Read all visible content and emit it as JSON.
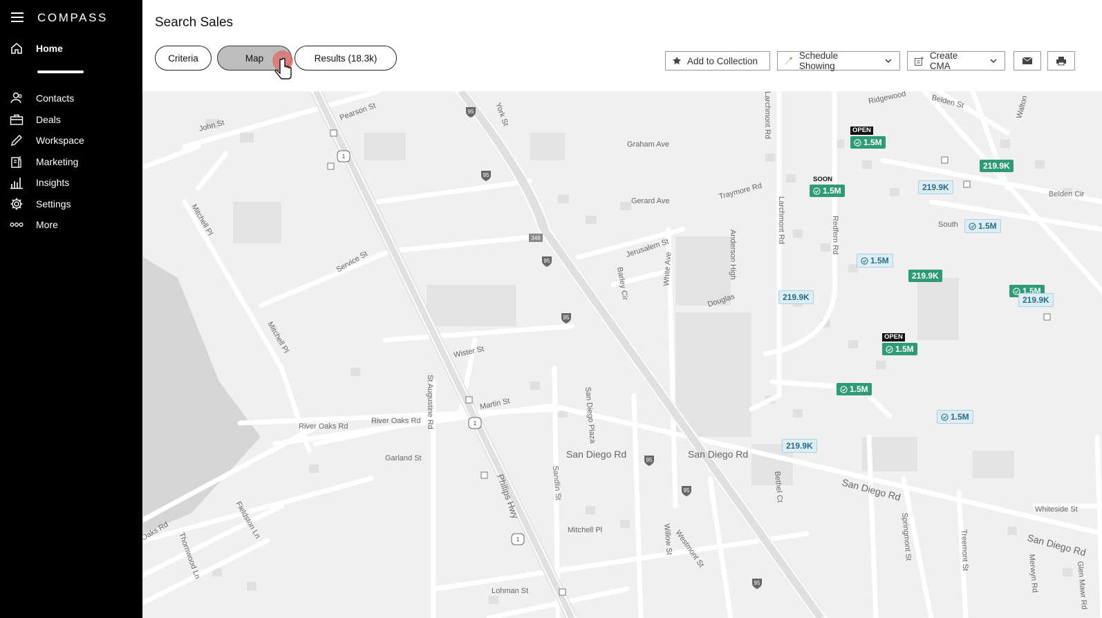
{
  "sidebar": {
    "brand": "COMPASS",
    "home_label": "Home",
    "items": [
      {
        "label": "Contacts",
        "icon": "contacts-icon"
      },
      {
        "label": "Deals",
        "icon": "deals-icon"
      },
      {
        "label": "Workspace",
        "icon": "workspace-icon"
      },
      {
        "label": "Marketing",
        "icon": "marketing-icon"
      },
      {
        "label": "Insights",
        "icon": "insights-icon"
      },
      {
        "label": "Settings",
        "icon": "settings-icon"
      },
      {
        "label": "More",
        "icon": "more-icon"
      }
    ]
  },
  "header": {
    "title": "Search Sales",
    "tabs": {
      "criteria": "Criteria",
      "map": "Map",
      "results": "Results (18.3k)"
    },
    "active_tab": "Map",
    "actions": {
      "add_to_collection": "Add to Collection",
      "schedule_showing": "Schedule Showing",
      "create_cma": "Create CMA"
    }
  },
  "map": {
    "streets": [
      "Pearson St",
      "John St",
      "York St",
      "Graham Ave",
      "Gerard Ave",
      "Traymore Rd",
      "Ridgewood",
      "Belden St",
      "Belden Cir",
      "South",
      "Service St",
      "Mitchell Pl",
      "Jerusalem St",
      "Barley Cir",
      "White Ave",
      "Anderson High",
      "Douglas",
      "Larchmont Rd",
      "Redfern Rd",
      "Wister St",
      "Martin St",
      "St Augustine Rd",
      "River Oaks Rd",
      "Garland St",
      "San Diego Rd",
      "San Diego Plaza",
      "Sandlin St",
      "Philips Hwy",
      "Westmont St",
      "Willow St",
      "Bethel Ct",
      "Springmont St",
      "Treemont St",
      "Whiteside St",
      "Lohman St",
      "Fieldston Ln",
      "Thornwood Ln",
      "Oaks Rd",
      "Merwyn Rd",
      "Glen Mawr Rd",
      "Walton"
    ],
    "shields": {
      "interstate": "95",
      "us": "1",
      "state": "348"
    },
    "tags": {
      "open": "OPEN",
      "soon": "SOON"
    },
    "markers": [
      {
        "price": "1.5M",
        "style": "green",
        "check": true
      },
      {
        "price": "1.5M",
        "style": "green",
        "check": true
      },
      {
        "price": "219.9K",
        "style": "green",
        "check": false
      },
      {
        "price": "219.9K",
        "style": "light",
        "check": false
      },
      {
        "price": "1.5M",
        "style": "light",
        "check": true
      },
      {
        "price": "1.5M",
        "style": "light",
        "check": true
      },
      {
        "price": "219.9K",
        "style": "green",
        "check": false
      },
      {
        "price": "219.9K",
        "style": "light",
        "check": false
      },
      {
        "price": "1.5M",
        "style": "green",
        "check": true
      },
      {
        "price": "219.9K",
        "style": "light",
        "check": false
      },
      {
        "price": "1.5M",
        "style": "green",
        "check": true
      },
      {
        "price": "1.5M",
        "style": "green",
        "check": true
      },
      {
        "price": "1.5M",
        "style": "light",
        "check": true
      },
      {
        "price": "219.9K",
        "style": "light",
        "check": false
      }
    ]
  },
  "colors": {
    "sidebar_bg": "#000000",
    "marker_green": "#2e9a77",
    "marker_light": "#dceef4",
    "cursor_ring": "#e06a6a"
  }
}
